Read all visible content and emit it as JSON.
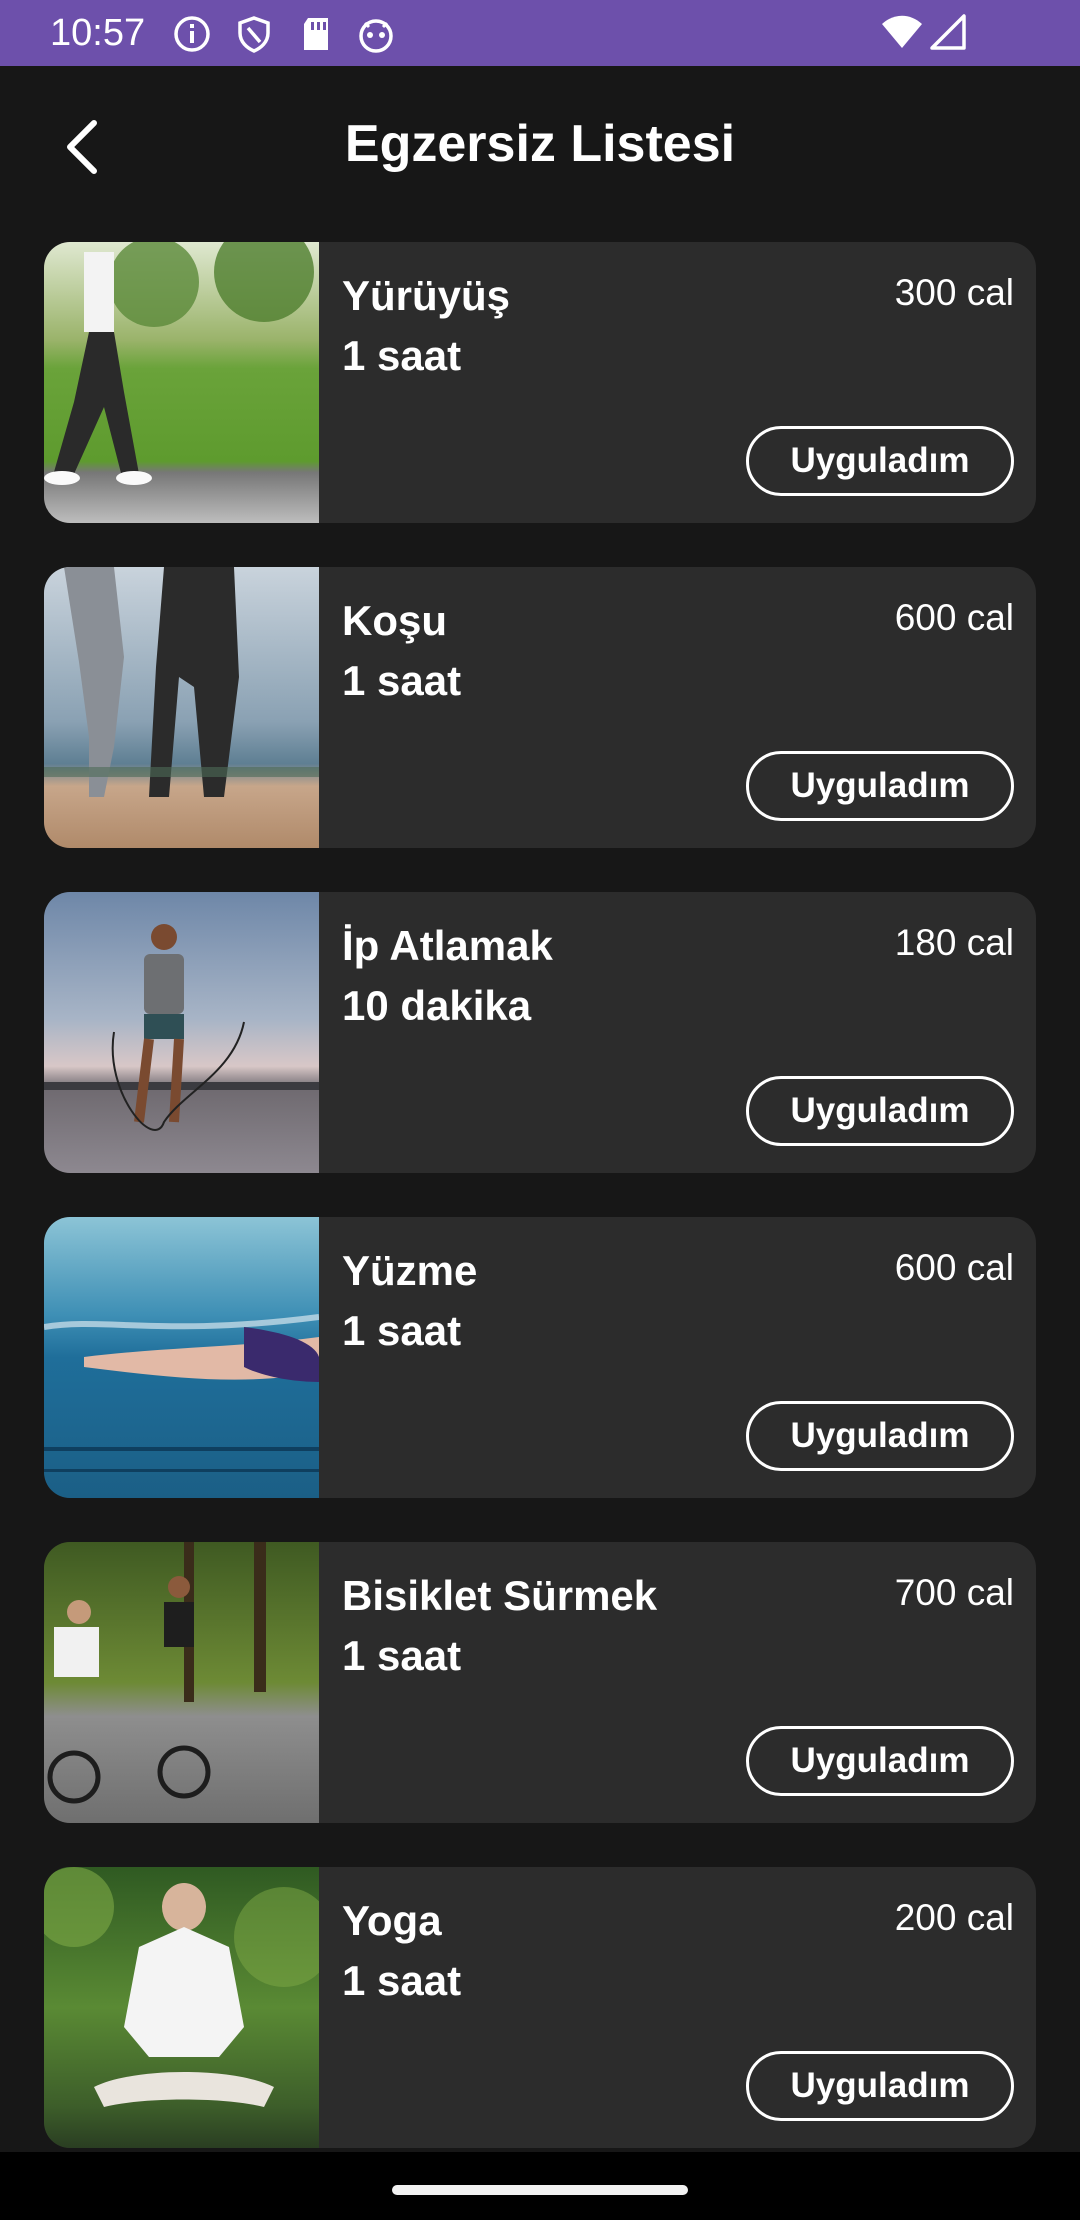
{
  "status_bar": {
    "time": "10:57",
    "icons": [
      "info-icon",
      "shield-icon",
      "sd-card-icon",
      "android-icon",
      "wifi-icon",
      "signal-icon"
    ],
    "color": "#6d50ab"
  },
  "header": {
    "title": "Egzersiz Listesi",
    "back_icon": "arrow-back-icon"
  },
  "exercises": [
    {
      "name": "Yürüyüş",
      "duration": "1 saat",
      "calories": "300 cal",
      "button": "Uyguladım",
      "image": "walking-photo"
    },
    {
      "name": "Koşu",
      "duration": "1 saat",
      "calories": "600 cal",
      "button": "Uyguladım",
      "image": "running-photo"
    },
    {
      "name": "İp Atlamak",
      "duration": "10 dakika",
      "calories": "180 cal",
      "button": "Uyguladım",
      "image": "jump-rope-photo"
    },
    {
      "name": "Yüzme",
      "duration": "1 saat",
      "calories": "600 cal",
      "button": "Uyguladım",
      "image": "swimming-photo"
    },
    {
      "name": "Bisiklet Sürmek",
      "duration": "1 saat",
      "calories": "700 cal",
      "button": "Uyguladım",
      "image": "cycling-photo"
    },
    {
      "name": "Yoga",
      "duration": "1 saat",
      "calories": "200 cal",
      "button": "Uyguladım",
      "image": "yoga-photo"
    }
  ],
  "colors": {
    "background": "#171717",
    "card": "#2c2c2c",
    "text": "#ffffff"
  }
}
